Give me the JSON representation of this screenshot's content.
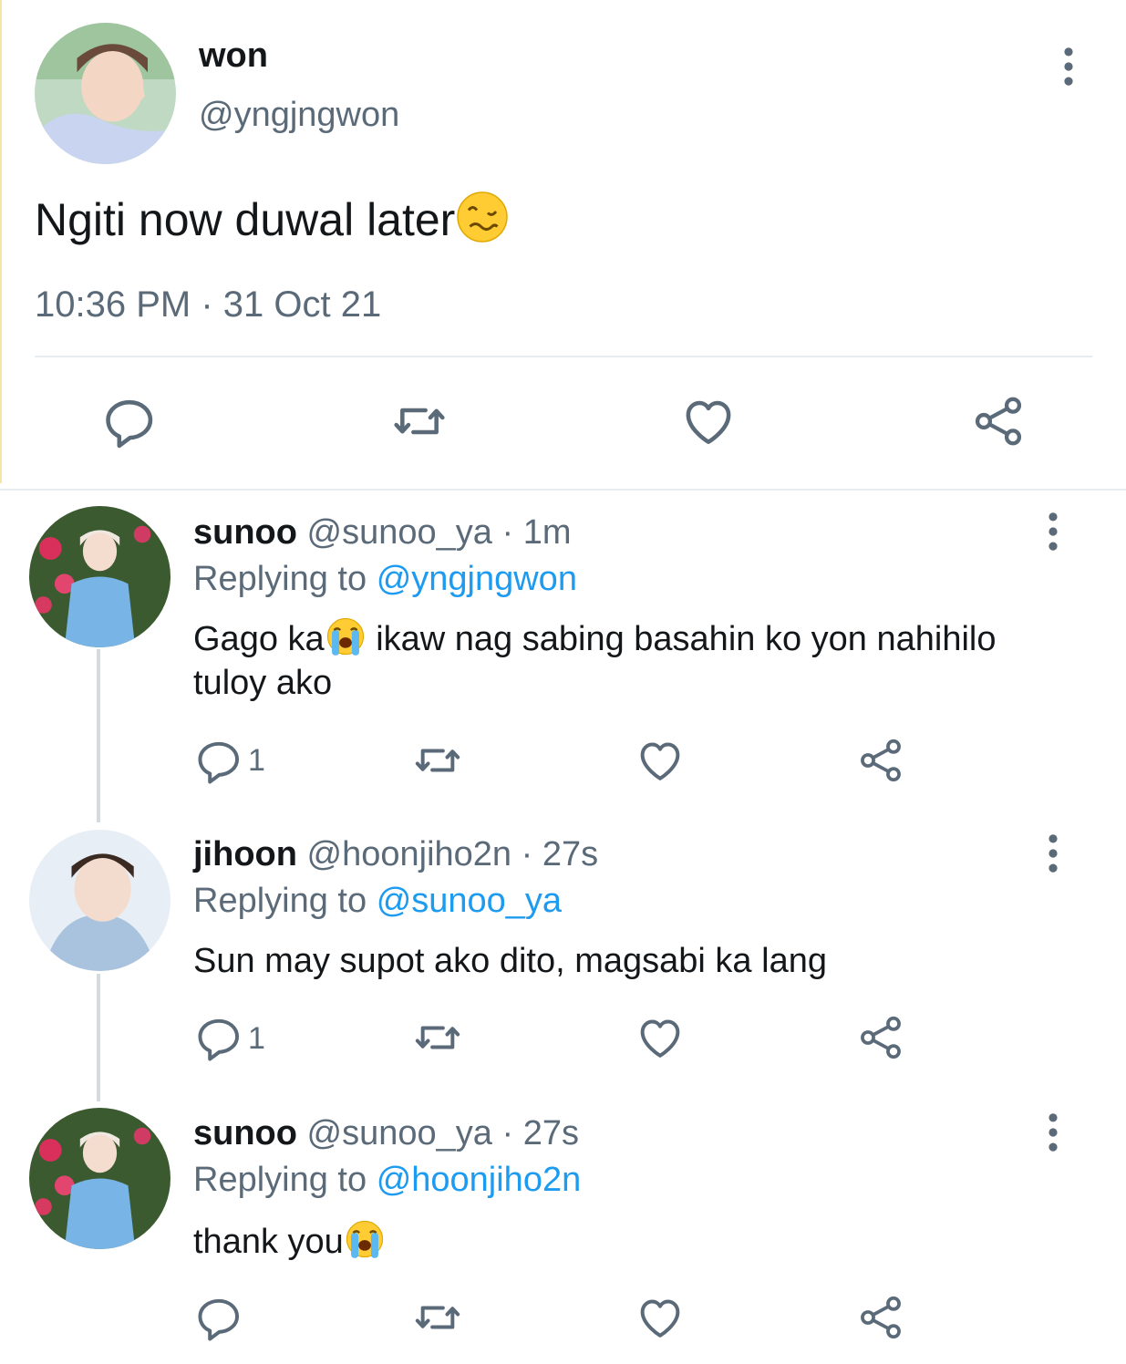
{
  "main_tweet": {
    "display_name": "won",
    "handle": "@yngjngwon",
    "text": "Ngiti now duwal later",
    "text_emoji": "woozy-face-emoji",
    "timestamp": "10:36 PM · 31 Oct 21",
    "avatar": "profile-photo-won",
    "actions": [
      "reply-icon",
      "retweet-icon",
      "like-icon",
      "share-icon"
    ]
  },
  "replies": [
    {
      "display_name": "sunoo",
      "meta": "@sunoo_ya · 1m",
      "replying_label": "Replying to",
      "replying_to": "@yngjngwon",
      "text_part1": "Gago ka",
      "text_emoji": "loudly-crying-face-emoji",
      "text_part2": " ikaw nag sabing basahin ko yon nahihilo tuloy ako",
      "reply_count": "1",
      "avatar": "profile-photo-sunoo"
    },
    {
      "display_name": "jihoon",
      "meta": "@hoonjiho2n · 27s",
      "replying_label": "Replying to",
      "replying_to": "@sunoo_ya",
      "text_part1": "Sun may supot ako dito, magsabi ka lang",
      "text_emoji": "",
      "text_part2": "",
      "reply_count": "1",
      "avatar": "profile-photo-jihoon"
    },
    {
      "display_name": "sunoo",
      "meta": "@sunoo_ya · 27s",
      "replying_label": "Replying to",
      "replying_to": "@hoonjiho2n",
      "text_part1": "thank you",
      "text_emoji": "loudly-crying-face-emoji",
      "text_part2": "",
      "reply_count": "",
      "avatar": "profile-photo-sunoo"
    }
  ],
  "colors": {
    "link": "#1d9bf0",
    "secondary_text": "#5b6a78",
    "icon": "#5b6a78",
    "divider": "#e6ecf0"
  }
}
